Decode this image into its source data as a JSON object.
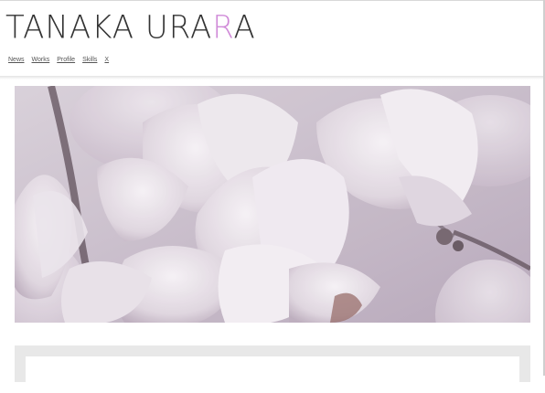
{
  "site": {
    "title_main": "TANAKA URA",
    "title_accent": "R",
    "title_end": "A"
  },
  "nav": {
    "items": [
      {
        "label": "News"
      },
      {
        "label": "Works"
      },
      {
        "label": "Profile"
      },
      {
        "label": "Skills"
      },
      {
        "label": "X"
      }
    ]
  },
  "hero": {
    "subject": "magnolia flowers photo"
  },
  "colors": {
    "accent": "#d08ad8",
    "text": "#333333"
  }
}
